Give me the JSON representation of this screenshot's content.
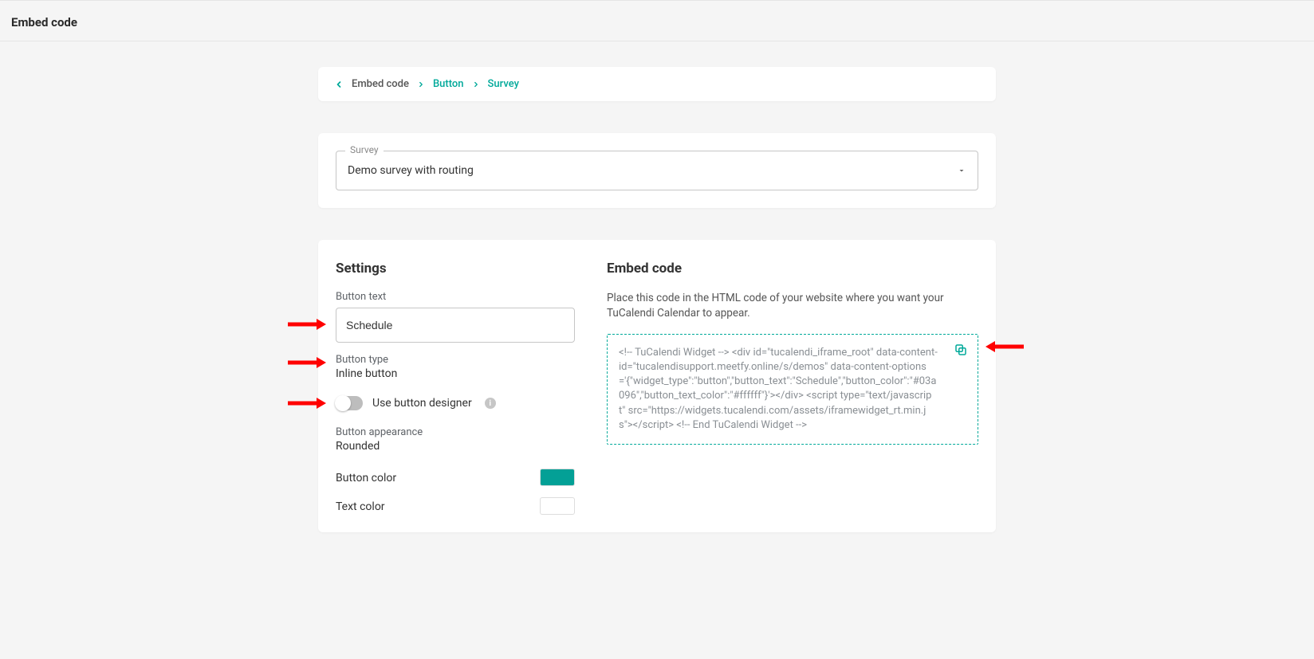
{
  "page_title": "Embed code",
  "breadcrumb": {
    "root": "Embed code",
    "segments": [
      "Button",
      "Survey"
    ]
  },
  "survey_select": {
    "label": "Survey",
    "value": "Demo survey with routing"
  },
  "settings": {
    "heading": "Settings",
    "button_text_label": "Button text",
    "button_text_value": "Schedule",
    "button_type_label": "Button type",
    "button_type_value": "Inline button",
    "use_designer_label": "Use button designer",
    "button_appearance_label": "Button appearance",
    "button_appearance_value": "Rounded",
    "button_color_label": "Button color",
    "button_color_value": "#03a096",
    "text_color_label": "Text color",
    "text_color_value": "#ffffff"
  },
  "embed": {
    "heading": "Embed code",
    "description": "Place this code in the HTML code of your website where you want your TuCalendi Calendar to appear.",
    "code": "<!-- TuCalendi Widget -->\n<div id=\"tucalendi_iframe_root\" data-content-id=\"tucalendisupport.meetfy.online/s/demos\" data-content-options='{\"widget_type\":\"button\",\"button_text\":\"Schedule\",\"button_color\":\"#03a096\",\"button_text_color\":\"#ffffff\"}'></div>\n<script type=\"text/javascript\" src=\"https://widgets.tucalendi.com/assets/iframewidget_rt.min.js\"></script>\n<!-- End TuCalendi Widget -->"
  }
}
